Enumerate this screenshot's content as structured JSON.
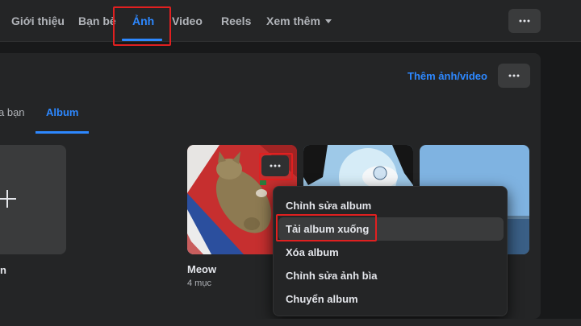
{
  "nav": {
    "tabs": [
      {
        "label": "Giới thiệu"
      },
      {
        "label": "Bạn bè"
      },
      {
        "label": "Ảnh"
      },
      {
        "label": "Video"
      },
      {
        "label": "Reels"
      },
      {
        "label": "Xem thêm"
      }
    ],
    "active_tab": "Ảnh",
    "more_icon": "more-horizontal-icon"
  },
  "photos_section": {
    "add_link": "Thêm ảnh/video",
    "subtabs": [
      {
        "label": "a bạn"
      },
      {
        "label": "Album"
      }
    ],
    "active_subtab": "Album"
  },
  "albums": [
    {
      "title": "n",
      "icon": "plus-icon"
    },
    {
      "title": "Meow",
      "count": "4 mục"
    }
  ],
  "album_menu": {
    "items": [
      {
        "label": "Chỉnh sửa album"
      },
      {
        "label": "Tải album xuống"
      },
      {
        "label": "Xóa album"
      },
      {
        "label": "Chỉnh sửa ảnh bìa"
      },
      {
        "label": "Chuyển album"
      }
    ],
    "highlighted_item": "Tải album xuống"
  },
  "colors": {
    "background": "#18191a",
    "surface": "#242526",
    "accent": "#2d88ff",
    "highlight_box": "#e02020",
    "text": "#e4e6eb",
    "secondary_text": "#b0b3b8"
  }
}
